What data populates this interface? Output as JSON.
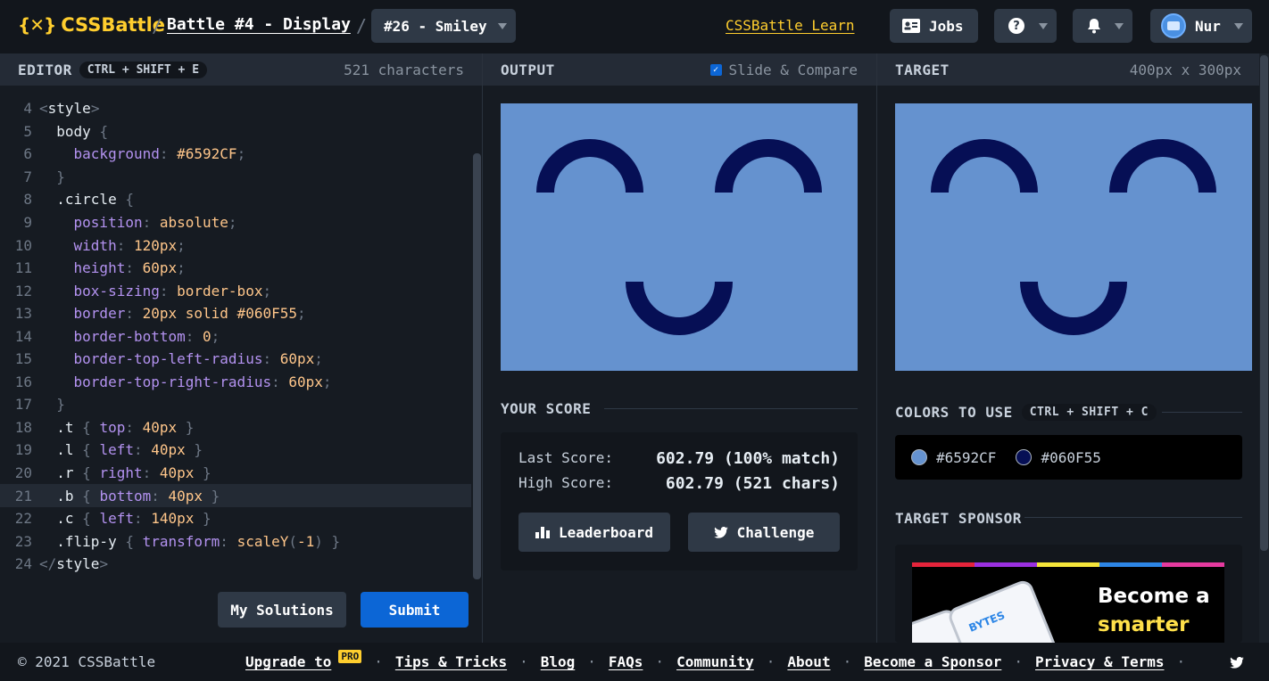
{
  "header": {
    "logo_mark": "{✕}",
    "logo_text": "CSSBattle",
    "sep1": "/",
    "battle_title": "Battle #4 - Display",
    "sep2": "/",
    "target_selected": "#26 - Smiley",
    "learn_link": "CSSBattle Learn",
    "jobs_label": "Jobs",
    "help_label": "?",
    "user_name": "Nur"
  },
  "editor": {
    "title": "EDITOR",
    "shortcut": "CTRL + SHIFT + E",
    "char_count": "521 characters",
    "lines": [
      {
        "n": "4",
        "tokens": [
          {
            "t": "punc",
            "v": "<"
          },
          {
            "t": "tag",
            "v": "style"
          },
          {
            "t": "punc",
            "v": ">"
          }
        ]
      },
      {
        "n": "5",
        "tokens": [
          {
            "t": "sel",
            "v": "  body "
          },
          {
            "t": "punc",
            "v": "{"
          }
        ]
      },
      {
        "n": "6",
        "tokens": [
          {
            "t": "sel",
            "v": "    "
          },
          {
            "t": "prop",
            "v": "background"
          },
          {
            "t": "punc",
            "v": ": "
          },
          {
            "t": "val",
            "v": "#6592CF"
          },
          {
            "t": "punc",
            "v": ";"
          }
        ]
      },
      {
        "n": "7",
        "tokens": [
          {
            "t": "punc",
            "v": "  }"
          }
        ]
      },
      {
        "n": "8",
        "tokens": [
          {
            "t": "sel",
            "v": "  .circle "
          },
          {
            "t": "punc",
            "v": "{"
          }
        ]
      },
      {
        "n": "9",
        "tokens": [
          {
            "t": "sel",
            "v": "    "
          },
          {
            "t": "prop",
            "v": "position"
          },
          {
            "t": "punc",
            "v": ": "
          },
          {
            "t": "val",
            "v": "absolute"
          },
          {
            "t": "punc",
            "v": ";"
          }
        ]
      },
      {
        "n": "10",
        "tokens": [
          {
            "t": "sel",
            "v": "    "
          },
          {
            "t": "prop",
            "v": "width"
          },
          {
            "t": "punc",
            "v": ": "
          },
          {
            "t": "val",
            "v": "120px"
          },
          {
            "t": "punc",
            "v": ";"
          }
        ]
      },
      {
        "n": "11",
        "tokens": [
          {
            "t": "sel",
            "v": "    "
          },
          {
            "t": "prop",
            "v": "height"
          },
          {
            "t": "punc",
            "v": ": "
          },
          {
            "t": "val",
            "v": "60px"
          },
          {
            "t": "punc",
            "v": ";"
          }
        ]
      },
      {
        "n": "12",
        "tokens": [
          {
            "t": "sel",
            "v": "    "
          },
          {
            "t": "prop",
            "v": "box-sizing"
          },
          {
            "t": "punc",
            "v": ": "
          },
          {
            "t": "val",
            "v": "border-box"
          },
          {
            "t": "punc",
            "v": ";"
          }
        ]
      },
      {
        "n": "13",
        "tokens": [
          {
            "t": "sel",
            "v": "    "
          },
          {
            "t": "prop",
            "v": "border"
          },
          {
            "t": "punc",
            "v": ": "
          },
          {
            "t": "val",
            "v": "20px solid #060F55"
          },
          {
            "t": "punc",
            "v": ";"
          }
        ]
      },
      {
        "n": "14",
        "tokens": [
          {
            "t": "sel",
            "v": "    "
          },
          {
            "t": "prop",
            "v": "border-bottom"
          },
          {
            "t": "punc",
            "v": ": "
          },
          {
            "t": "val",
            "v": "0"
          },
          {
            "t": "punc",
            "v": ";"
          }
        ]
      },
      {
        "n": "15",
        "tokens": [
          {
            "t": "sel",
            "v": "    "
          },
          {
            "t": "prop",
            "v": "border-top-left-radius"
          },
          {
            "t": "punc",
            "v": ": "
          },
          {
            "t": "val",
            "v": "60px"
          },
          {
            "t": "punc",
            "v": ";"
          }
        ]
      },
      {
        "n": "16",
        "tokens": [
          {
            "t": "sel",
            "v": "    "
          },
          {
            "t": "prop",
            "v": "border-top-right-radius"
          },
          {
            "t": "punc",
            "v": ": "
          },
          {
            "t": "val",
            "v": "60px"
          },
          {
            "t": "punc",
            "v": ";"
          }
        ]
      },
      {
        "n": "17",
        "tokens": [
          {
            "t": "punc",
            "v": "  }"
          }
        ]
      },
      {
        "n": "18",
        "tokens": [
          {
            "t": "sel",
            "v": "  .t "
          },
          {
            "t": "punc",
            "v": "{ "
          },
          {
            "t": "prop",
            "v": "top"
          },
          {
            "t": "punc",
            "v": ": "
          },
          {
            "t": "val",
            "v": "40px"
          },
          {
            "t": "punc",
            "v": " }"
          }
        ]
      },
      {
        "n": "19",
        "tokens": [
          {
            "t": "sel",
            "v": "  .l "
          },
          {
            "t": "punc",
            "v": "{ "
          },
          {
            "t": "prop",
            "v": "left"
          },
          {
            "t": "punc",
            "v": ": "
          },
          {
            "t": "val",
            "v": "40px"
          },
          {
            "t": "punc",
            "v": " }"
          }
        ]
      },
      {
        "n": "20",
        "tokens": [
          {
            "t": "sel",
            "v": "  .r "
          },
          {
            "t": "punc",
            "v": "{ "
          },
          {
            "t": "prop",
            "v": "right"
          },
          {
            "t": "punc",
            "v": ": "
          },
          {
            "t": "val",
            "v": "40px"
          },
          {
            "t": "punc",
            "v": " }"
          }
        ]
      },
      {
        "n": "21",
        "active": true,
        "tokens": [
          {
            "t": "sel",
            "v": "  .b "
          },
          {
            "t": "punc",
            "v": "{ "
          },
          {
            "t": "prop",
            "v": "bottom"
          },
          {
            "t": "punc",
            "v": ": "
          },
          {
            "t": "val",
            "v": "40px"
          },
          {
            "t": "punc",
            "v": " }"
          }
        ]
      },
      {
        "n": "22",
        "tokens": [
          {
            "t": "sel",
            "v": "  .c "
          },
          {
            "t": "punc",
            "v": "{ "
          },
          {
            "t": "prop",
            "v": "left"
          },
          {
            "t": "punc",
            "v": ": "
          },
          {
            "t": "val",
            "v": "140px"
          },
          {
            "t": "punc",
            "v": " }"
          }
        ]
      },
      {
        "n": "23",
        "tokens": [
          {
            "t": "sel",
            "v": "  .flip-y "
          },
          {
            "t": "punc",
            "v": "{ "
          },
          {
            "t": "prop",
            "v": "transform"
          },
          {
            "t": "punc",
            "v": ": "
          },
          {
            "t": "val",
            "v": "scaleY"
          },
          {
            "t": "punc",
            "v": "("
          },
          {
            "t": "val",
            "v": "-1"
          },
          {
            "t": "punc",
            "v": ") }"
          }
        ]
      },
      {
        "n": "24",
        "tokens": [
          {
            "t": "punc",
            "v": "</"
          },
          {
            "t": "tag",
            "v": "style"
          },
          {
            "t": "punc",
            "v": ">"
          }
        ]
      }
    ],
    "my_solutions_label": "My Solutions",
    "submit_label": "Submit"
  },
  "output": {
    "title": "OUTPUT",
    "slide_compare_label": "Slide & Compare",
    "slide_compare_checked": true
  },
  "score": {
    "title": "YOUR SCORE",
    "last_label": "Last Score:",
    "last_value": "602.79 (100% match)",
    "high_label": "High Score:",
    "high_value": "602.79 (521 chars)",
    "leaderboard_label": "Leaderboard",
    "challenge_label": "Challenge"
  },
  "target": {
    "title": "TARGET",
    "dimensions": "400px x 300px",
    "colors_title": "COLORS TO USE",
    "colors_shortcut": "CTRL + SHIFT + C",
    "colors": [
      "#6592CF",
      "#060F55"
    ],
    "sponsor_title": "TARGET SPONSOR",
    "sponsor_line1": "Become a",
    "sponsor_line2": "smarter",
    "sponsor_brand": "BYTES"
  },
  "footer": {
    "copyright": "© 2021 CSSBattle",
    "upgrade_label": "Upgrade to",
    "pro_badge": "PRO",
    "links": [
      "Tips & Tricks",
      "Blog",
      "FAQs",
      "Community",
      "About",
      "Become a Sponsor",
      "Privacy & Terms"
    ],
    "dot": "·"
  }
}
